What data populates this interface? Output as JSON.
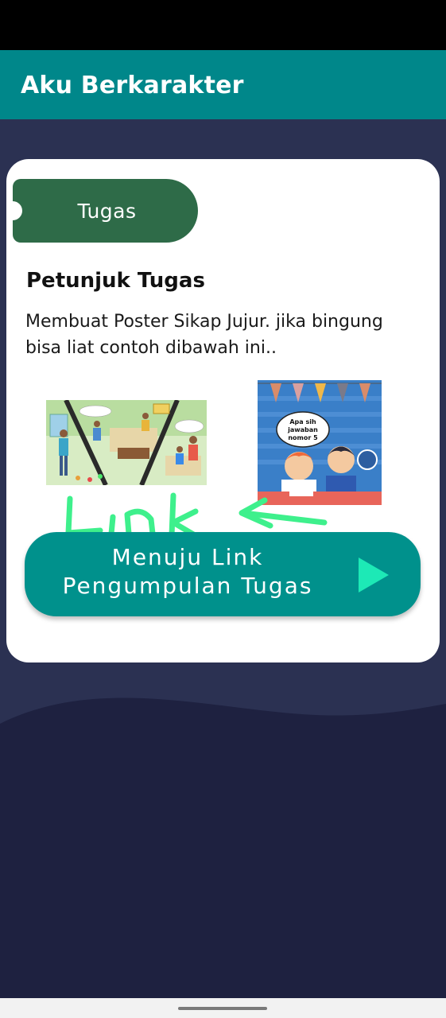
{
  "app": {
    "title": "Aku Berkarakter"
  },
  "card": {
    "tag_label": "Tugas",
    "heading": "Petunjuk Tugas",
    "description": "Membuat Poster Sikap Jujur. jika bingung bisa liat contoh dibawah ini..",
    "images": [
      {
        "name": "example-poster-1",
        "speech": [
          "...",
          "..."
        ]
      },
      {
        "name": "example-poster-2",
        "speech": [
          "Apa sih",
          "jawaban",
          "nomor 5"
        ]
      }
    ],
    "annotation": "Link",
    "cta": {
      "line1": "Menuju Link",
      "line2": "Pengumpulan Tugas",
      "icon": "play-icon"
    }
  },
  "colors": {
    "app_bar": "#00878a",
    "tag": "#2e6b48",
    "cta": "#00918c",
    "play_icon": "#1de9b6",
    "scribble": "#3ef08c",
    "background": "#1e2140"
  }
}
